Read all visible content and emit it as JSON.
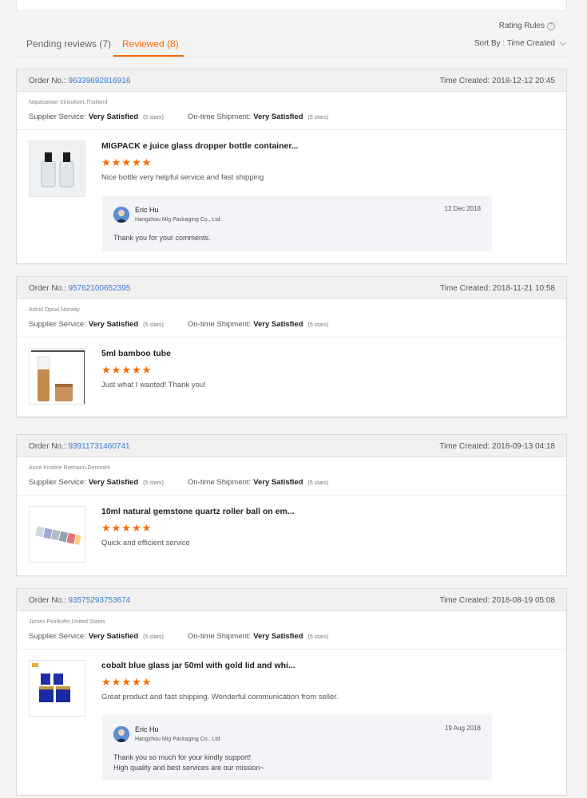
{
  "header": {
    "rating_rules": "Rating Rules",
    "tabs": [
      {
        "label": "Pending reviews (7)"
      },
      {
        "label": "Reviewed (8)"
      }
    ],
    "sort_label": "Sort By : Time Created"
  },
  "labels": {
    "order_no": "Order No.:",
    "time_created": "Time Created:",
    "supplier_service": "Supplier Service:",
    "on_time_shipment": "On-time Shipment:"
  },
  "reviews": [
    {
      "order_no": "96339692816916",
      "time_created": "2018-12-12 20:45",
      "buyer": "Napasawan Sirisukont,Thailand",
      "supplier_rating": "Very Satisfied",
      "supplier_stars": "(5 stars)",
      "shipment_rating": "Very Satisfied",
      "shipment_stars": "(5 stars)",
      "product_title": "MIGPACK e juice glass dropper bottle container...",
      "stars": "★★★★★",
      "comment": "Nice bottle very helpful service and fast shipping",
      "reply": {
        "name": "Eric Hu",
        "company": "Hangzhou Mig Packaging Co., Ltd.",
        "date": "12 Dec 2018",
        "text": [
          "Thank you for your comments."
        ]
      }
    },
    {
      "order_no": "95762100652395",
      "time_created": "2018-11-21 10:58",
      "buyer": "Astrid Opsal,Norway",
      "supplier_rating": "Very Satisfied",
      "supplier_stars": "(5 stars)",
      "shipment_rating": "Very Satisfied",
      "shipment_stars": "(5 stars)",
      "product_title": "5ml bamboo tube",
      "stars": "★★★★★",
      "comment": "Just what I wanted! Thank you!"
    },
    {
      "order_no": "93911731460741",
      "time_created": "2018-09-13 04:18",
      "buyer": "Anne Kirstine Riemann,Denmark",
      "supplier_rating": "Very Satisfied",
      "supplier_stars": "(5 stars)",
      "shipment_rating": "Very Satisfied",
      "shipment_stars": "(5 stars)",
      "product_title": "10ml natural gemstone quartz roller ball on em...",
      "stars": "★★★★★",
      "comment": "Quick and efficient service"
    },
    {
      "order_no": "93575293753674",
      "time_created": "2018-08-19 05:08",
      "buyer": "James Peinkofer,United States",
      "supplier_rating": "Very Satisfied",
      "supplier_stars": "(5 stars)",
      "shipment_rating": "Very Satisfied",
      "shipment_stars": "(5 stars)",
      "product_title": "cobalt blue glass jar 50ml with gold lid and whi...",
      "stars": "★★★★★",
      "comment": "Great product and fast shipping. Wonderful communication from seller.",
      "reply": {
        "name": "Eric Hu",
        "company": "Hangzhou Mig Packaging Co., Ltd.",
        "date": "19 Aug 2018",
        "text": [
          "Thank you so much for your kindly support!",
          "High quality and best services are our mission~"
        ]
      }
    }
  ],
  "colors": {
    "accent": "#ff6a00",
    "link": "#3a7bd5",
    "star": "#ff6a00"
  }
}
